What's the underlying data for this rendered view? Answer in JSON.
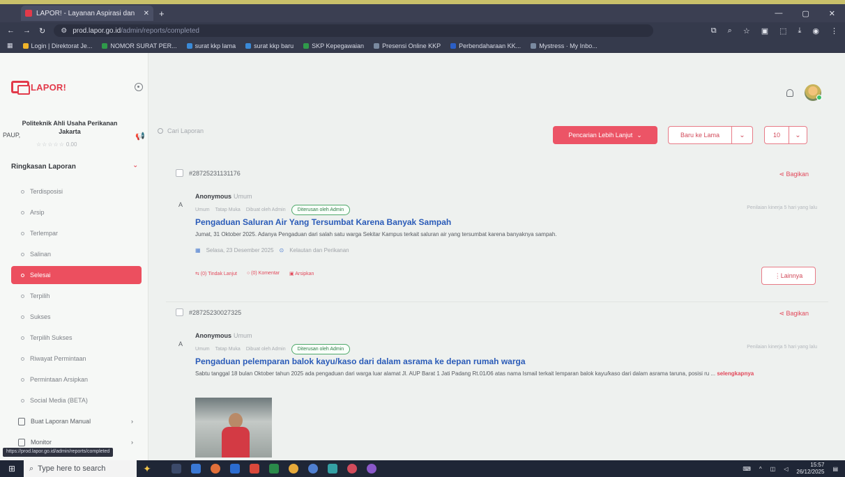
{
  "browser": {
    "tab_title": "LAPOR! - Layanan Aspirasi dan",
    "url_host": "prod.lapor.go.id",
    "url_path": "/admin/reports/completed",
    "bookmarks": [
      {
        "label": "Login | Direktorat Je...",
        "color": "#f0b429"
      },
      {
        "label": "NOMOR SURAT PER...",
        "color": "#2f9a4a"
      },
      {
        "label": "surat kkp lama",
        "color": "#3a8ad8"
      },
      {
        "label": "surat kkp baru",
        "color": "#3a8ad8"
      },
      {
        "label": "SKP Kepegawaian",
        "color": "#2f9a4a"
      },
      {
        "label": "Presensi Online KKP",
        "color": "#7a8aa0"
      },
      {
        "label": "Perbendaharaan KK...",
        "color": "#2b5fc6"
      },
      {
        "label": "Mystress · My Inbo...",
        "color": "#7a8aa0"
      }
    ]
  },
  "app": {
    "logo_text": "LAPOR!",
    "institution": {
      "prefix": "PAUP,",
      "name": "Politeknik Ahli Usaha Perikanan Jakarta",
      "stars": "☆☆☆☆☆",
      "rating": "0.00"
    },
    "section_title": "Ringkasan Laporan",
    "menu": [
      {
        "label": "Terdisposisi",
        "active": false
      },
      {
        "label": "Arsip",
        "active": false
      },
      {
        "label": "Terlempar",
        "active": false
      },
      {
        "label": "Salinan",
        "active": false
      },
      {
        "label": "Selesai",
        "active": true
      },
      {
        "label": "Terpilih",
        "active": false
      },
      {
        "label": "Sukses",
        "active": false
      },
      {
        "label": "Terpilih Sukses",
        "active": false
      },
      {
        "label": "Riwayat Permintaan",
        "active": false
      },
      {
        "label": "Permintaan Arsipkan",
        "active": false
      },
      {
        "label": "Social Media (BETA)",
        "active": false
      }
    ],
    "groups": [
      {
        "label": "Buat Laporan Manual"
      },
      {
        "label": "Monitor"
      }
    ],
    "status_url": "https://prod.lapor.go.id/admin/reports/completed"
  },
  "toolbar": {
    "search_placeholder": "Cari Laporan",
    "advanced_search": "Pencarian Lebih Lanjut",
    "sort_label": "Baru ke Lama",
    "per_page": "10"
  },
  "reports": [
    {
      "id": "#28725231131176",
      "share": "Bagikan",
      "author": "Anonymous",
      "category": "Umum",
      "meta": [
        "Umum",
        "Tatap Muka",
        "Dibuat oleh Admin"
      ],
      "status": "Diterusan oleh Admin",
      "period": "Penilaian kinerja 5 hari yang lalu",
      "title": "Pengaduan Saluran Air Yang Tersumbat Karena Banyak Sampah",
      "body": "Jumat, 31 Oktober 2025. Adanya Pengaduan dari salah satu warga Sekitar Kampus terkait saluran air yang tersumbat karena banyaknya sampah.",
      "date": "Selasa, 23 Desember 2025",
      "agency": "Kelautan dan Perikanan",
      "actions": [
        "Tindak Lanjut",
        "Komentar",
        "Arsipkan"
      ],
      "more": "Lainnya"
    },
    {
      "id": "#28725230027325",
      "share": "Bagikan",
      "author": "Anonymous",
      "category": "Umum",
      "meta": [
        "Umum",
        "Tatap Muka",
        "Dibuat oleh Admin"
      ],
      "status": "Diterusan oleh Admin",
      "period": "Penilaian kinerja 5 hari yang lalu",
      "title": "Pengaduan pelemparan balok kayu/kaso dari dalam asrama ke depan rumah warga",
      "body": "Sabtu tanggal 18 bulan Oktober tahun 2025 ada pengaduan dari warga luar alamat Jl. AUP Barat 1 Jati Padang Rt.01/06 atas nama Ismail terkait lemparan balok kayu/kaso dari dalam asrama taruna, posisi ru ...",
      "readmore": "selengkapnya"
    }
  ],
  "taskbar": {
    "search_placeholder": "Type here to search",
    "time": "15:57",
    "date": "26/12/2025"
  }
}
